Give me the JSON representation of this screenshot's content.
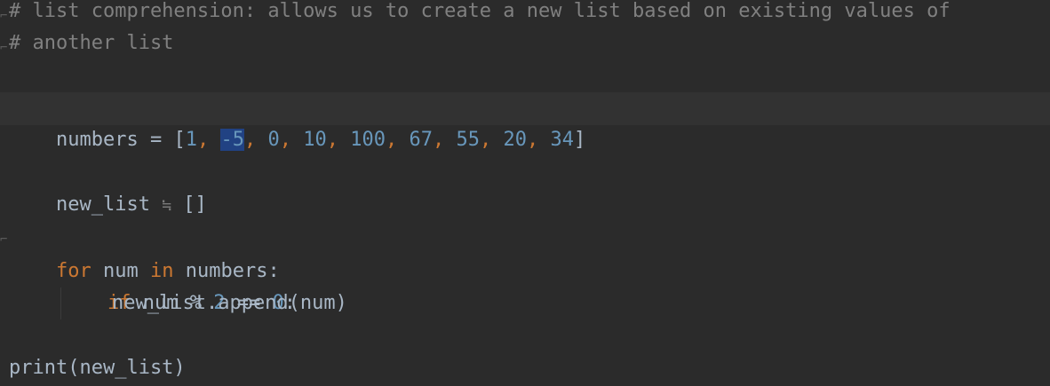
{
  "editor": {
    "language": "python",
    "colors": {
      "background": "#2b2b2b",
      "comment": "#808080",
      "keyword": "#cc7832",
      "number": "#6897bb",
      "text": "#a9b7c6",
      "selection": "#214283"
    },
    "lines": {
      "comment1": "# list comprehension: allows us to create a new list based on existing values of",
      "comment2": "# another list",
      "numbers_name": "numbers",
      "assign": " = ",
      "lbracket": "[",
      "rbracket": "]",
      "comma": ", ",
      "numbers_values": [
        "1",
        "-5",
        "0",
        "10",
        "100",
        "67",
        "55",
        "20",
        "34"
      ],
      "new_list_name": "new_list",
      "empty_list": "[]",
      "for_kw": "for",
      "loop_var": "num",
      "in_kw": "in",
      "iter_name": "numbers:",
      "if_kw": "if",
      "cond_var": "num",
      "mod_op": " % ",
      "mod_num": "2",
      "eq_op": " == ",
      "zero": "0",
      "colon": ":",
      "append_call": "new_list.append(num)",
      "print_call": "print(new_list)"
    }
  }
}
